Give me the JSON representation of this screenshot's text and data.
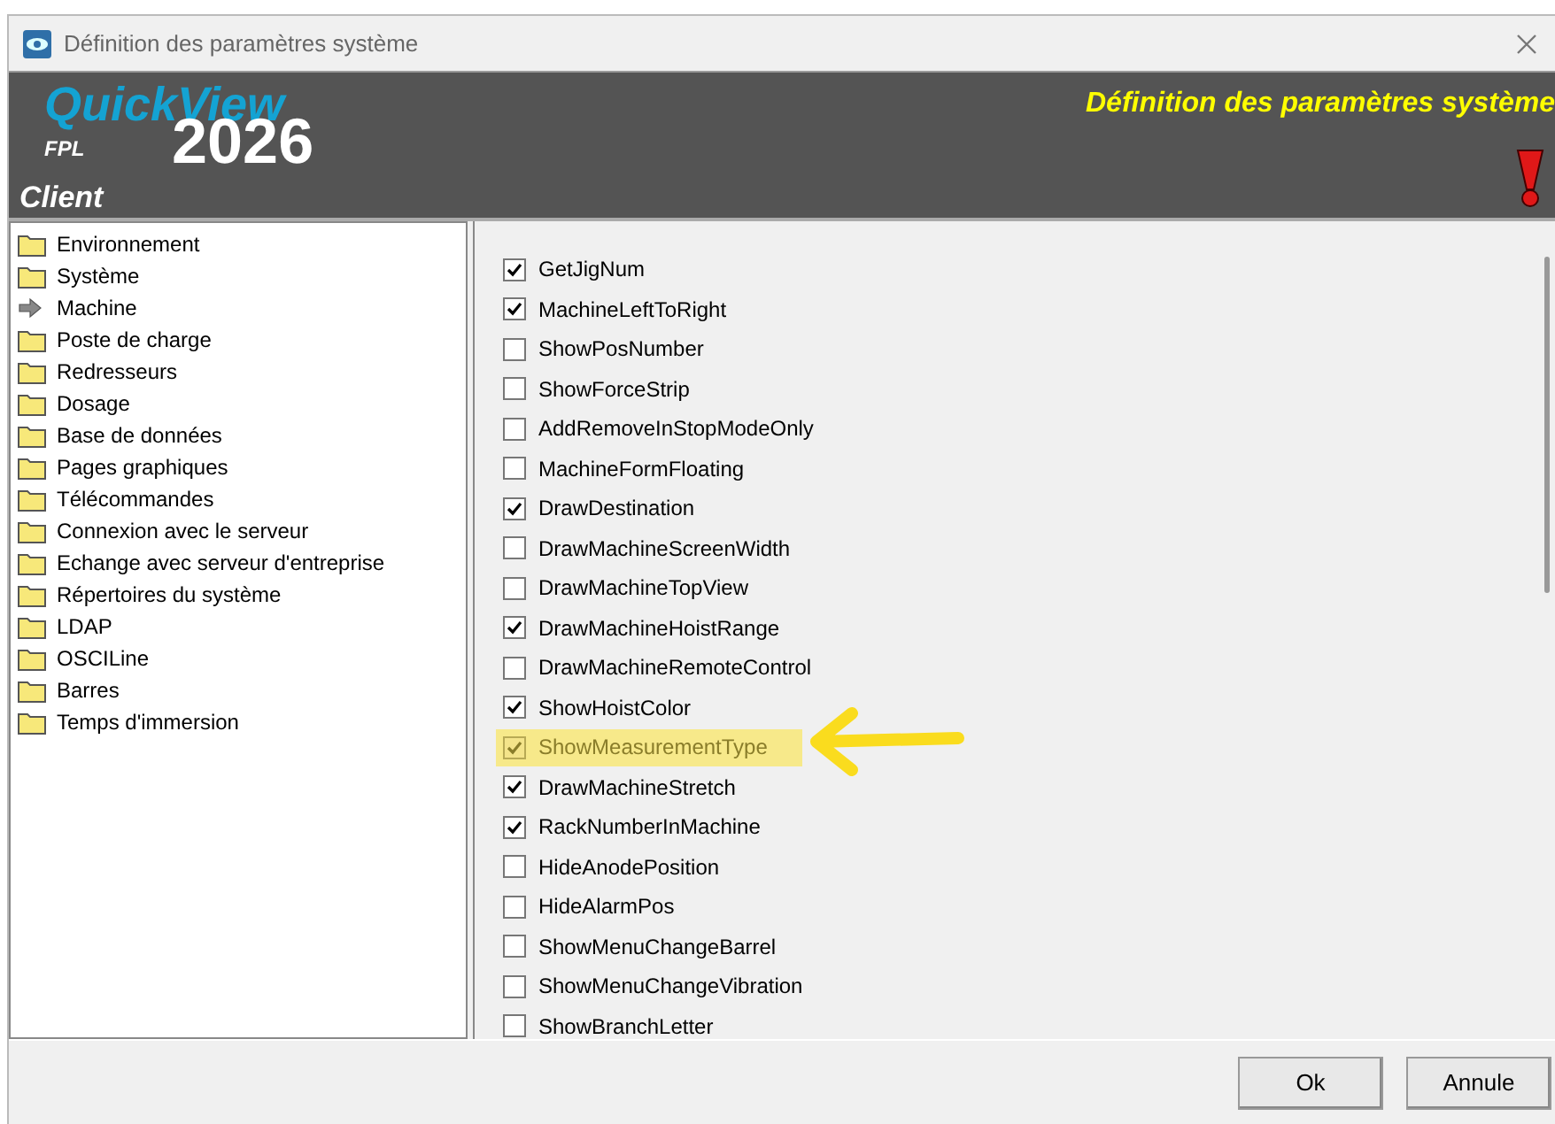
{
  "window": {
    "title": "Définition des paramètres système"
  },
  "header": {
    "brand": "QuickView",
    "sub": "FPL",
    "year": "2026",
    "client": "Client",
    "title": "Définition des paramètres système"
  },
  "tree": [
    {
      "label": "Environnement",
      "kind": "folder"
    },
    {
      "label": "Système",
      "kind": "folder"
    },
    {
      "label": "Machine",
      "kind": "arrow"
    },
    {
      "label": "Poste de charge",
      "kind": "folder"
    },
    {
      "label": "Redresseurs",
      "kind": "folder"
    },
    {
      "label": "Dosage",
      "kind": "folder"
    },
    {
      "label": "Base de données",
      "kind": "folder"
    },
    {
      "label": "Pages graphiques",
      "kind": "folder"
    },
    {
      "label": "Télécommandes",
      "kind": "folder"
    },
    {
      "label": "Connexion avec le serveur",
      "kind": "folder"
    },
    {
      "label": "Echange avec serveur d'entreprise",
      "kind": "folder"
    },
    {
      "label": "Répertoires du système",
      "kind": "folder"
    },
    {
      "label": "LDAP",
      "kind": "folder"
    },
    {
      "label": "OSCILine",
      "kind": "folder"
    },
    {
      "label": "Barres",
      "kind": "folder"
    },
    {
      "label": "Temps d'immersion",
      "kind": "folder"
    }
  ],
  "options": [
    {
      "label": "GetJigNum",
      "checked": true,
      "highlighted": false
    },
    {
      "label": "MachineLeftToRight",
      "checked": true,
      "highlighted": false
    },
    {
      "label": "ShowPosNumber",
      "checked": false,
      "highlighted": false
    },
    {
      "label": "ShowForceStrip",
      "checked": false,
      "highlighted": false
    },
    {
      "label": "AddRemoveInStopModeOnly",
      "checked": false,
      "highlighted": false
    },
    {
      "label": "MachineFormFloating",
      "checked": false,
      "highlighted": false
    },
    {
      "label": "DrawDestination",
      "checked": true,
      "highlighted": false
    },
    {
      "label": "DrawMachineScreenWidth",
      "checked": false,
      "highlighted": false
    },
    {
      "label": "DrawMachineTopView",
      "checked": false,
      "highlighted": false
    },
    {
      "label": "DrawMachineHoistRange",
      "checked": true,
      "highlighted": false
    },
    {
      "label": "DrawMachineRemoteControl",
      "checked": false,
      "highlighted": false
    },
    {
      "label": "ShowHoistColor",
      "checked": true,
      "highlighted": false
    },
    {
      "label": "ShowMeasurementType",
      "checked": true,
      "highlighted": true
    },
    {
      "label": "DrawMachineStretch",
      "checked": true,
      "highlighted": false
    },
    {
      "label": "RackNumberInMachine",
      "checked": true,
      "highlighted": false
    },
    {
      "label": "HideAnodePosition",
      "checked": false,
      "highlighted": false
    },
    {
      "label": "HideAlarmPos",
      "checked": false,
      "highlighted": false
    },
    {
      "label": "ShowMenuChangeBarrel",
      "checked": false,
      "highlighted": false
    },
    {
      "label": "ShowMenuChangeVibration",
      "checked": false,
      "highlighted": false
    },
    {
      "label": "ShowBranchLetter",
      "checked": false,
      "highlighted": false
    }
  ],
  "buttons": [
    "Ok",
    "Annule"
  ]
}
